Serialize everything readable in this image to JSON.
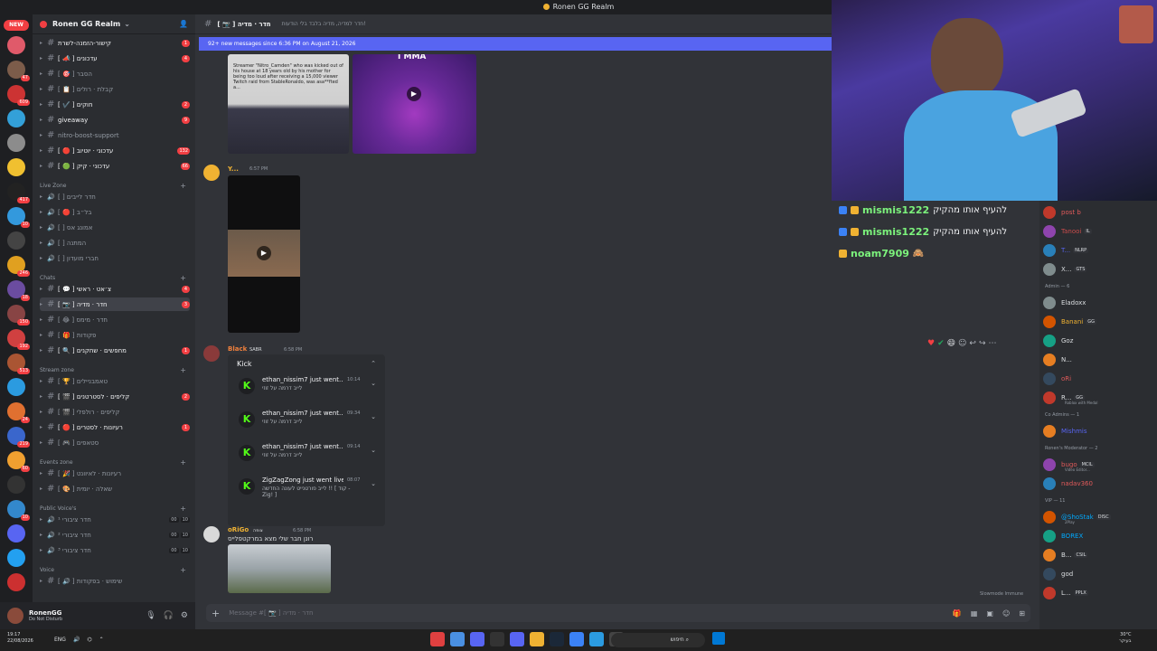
{
  "title_bar": {
    "title": "Ronen GG Realm"
  },
  "rail": {
    "new_label": "NEW",
    "servers": [
      {
        "color": "#e05a6a",
        "badge": ""
      },
      {
        "color": "#7c5c4a",
        "badge": "47"
      },
      {
        "color": "#cc3333",
        "badge": "609"
      },
      {
        "color": "#33a0d8",
        "badge": ""
      },
      {
        "color": "#8c8c8c",
        "badge": ""
      },
      {
        "color": "#f0c030",
        "badge": ""
      },
      {
        "color": "#222222",
        "badge": "417"
      },
      {
        "color": "#3399dd",
        "badge": "10"
      },
      {
        "color": "#444444",
        "badge": ""
      },
      {
        "color": "#e0a020",
        "badge": "246"
      },
      {
        "color": "#6b4ca0",
        "badge": "18"
      },
      {
        "color": "#884444",
        "badge": "150"
      },
      {
        "color": "#d04040",
        "badge": "192"
      },
      {
        "color": "#aa5533",
        "badge": "513"
      },
      {
        "color": "#2b9be0",
        "badge": ""
      },
      {
        "color": "#e07030",
        "badge": "24"
      },
      {
        "color": "#3a66cc",
        "badge": "219"
      },
      {
        "color": "#f0a030",
        "badge": "60"
      },
      {
        "color": "#333333",
        "badge": ""
      },
      {
        "color": "#3388cc",
        "badge": "10"
      },
      {
        "color": "#5865f2",
        "badge": ""
      },
      {
        "color": "#23a0f0",
        "badge": ""
      },
      {
        "color": "#cc3030",
        "badge": ""
      }
    ]
  },
  "server": {
    "name": "Ronen GG Realm"
  },
  "channels": [
    {
      "type": "ch",
      "name": "קישור-הזמנה-לשרת",
      "badge": "1"
    },
    {
      "type": "ch",
      "name": "[ 📣 ] עדכונים",
      "badge": "4"
    },
    {
      "type": "ch",
      "name": "[ 🎯 ] הסבר",
      "badge": ""
    },
    {
      "type": "ch",
      "name": "[ 📋 ] קבלת · רולים",
      "badge": ""
    },
    {
      "type": "ch",
      "name": "[ ✔️ ] חוקים",
      "badge": "2"
    },
    {
      "type": "ch",
      "name": "giveaway",
      "badge": "9"
    },
    {
      "type": "ch",
      "name": "nitro-boost-support",
      "badge": ""
    },
    {
      "type": "ch",
      "name": "[ 🔴 ] עדכוני · יוטיוב",
      "badge": "132"
    },
    {
      "type": "ch",
      "name": "[ 🟢 ] עדכוני · קיק",
      "badge": "66"
    },
    {
      "type": "cat",
      "name": "Live Zone"
    },
    {
      "type": "voice",
      "name": "[ ] חדר לייבים",
      "badge": ""
    },
    {
      "type": "voice",
      "name": "[ 🔴 ] בל״ב",
      "badge": ""
    },
    {
      "type": "voice",
      "name": "[ ] אמונג אס",
      "badge": ""
    },
    {
      "type": "voice",
      "name": "[ ] המתנה",
      "badge": ""
    },
    {
      "type": "voice",
      "name": "[ ] חברי מועדון",
      "badge": ""
    },
    {
      "type": "cat",
      "name": "Chats"
    },
    {
      "type": "ch",
      "name": "[ 💬 ] צ׳אט · ראשי",
      "badge": "4"
    },
    {
      "type": "ch",
      "name": "[ 📷 ] חדר · מדיה",
      "badge": "3",
      "selected": true
    },
    {
      "type": "ch",
      "name": "[ 😂 ] חדר · מימס",
      "badge": ""
    },
    {
      "type": "ch",
      "name": "[ 🎁 ] פקודות",
      "badge": ""
    },
    {
      "type": "ch",
      "name": "[ 🔍 ] מחפשים · שחקנים",
      "badge": "1"
    },
    {
      "type": "cat",
      "name": "Stream zone"
    },
    {
      "type": "ch",
      "name": "[ 🏆 ] טאמבניילים",
      "badge": ""
    },
    {
      "type": "ch",
      "name": "[ 🎬 ] קליפים · לסטרטנים",
      "badge": "2"
    },
    {
      "type": "ch",
      "name": "[ 🎬 ] קליפים · רולפלי",
      "badge": ""
    },
    {
      "type": "ch",
      "name": "[ 🔴 ] רעיונות · לסטרים",
      "badge": "1"
    },
    {
      "type": "ch",
      "name": "[ 🎮 ] סטאפים",
      "badge": ""
    },
    {
      "type": "cat",
      "name": "Events zone"
    },
    {
      "type": "ch",
      "name": "[ 🎉 ] רעיונות · לאיוונט",
      "badge": ""
    },
    {
      "type": "ch",
      "name": "[ 🎨 ] שאלה · יומית",
      "badge": ""
    },
    {
      "type": "cat",
      "name": "Public Voice's"
    },
    {
      "type": "voice",
      "name": "חדר ציבורי ¹",
      "counts": [
        "00",
        "10"
      ]
    },
    {
      "type": "voice",
      "name": "חדר ציבורי ²",
      "counts": [
        "00",
        "10"
      ]
    },
    {
      "type": "voice",
      "name": "חדר ציבורי ³",
      "counts": [
        "00",
        "10"
      ]
    },
    {
      "type": "cat",
      "name": "Voice"
    },
    {
      "type": "ch",
      "name": "[ 🔊 ] שימוש · בפקודות",
      "badge": ""
    }
  ],
  "user": {
    "name": "RonenGG",
    "status": "Do Not Disturb"
  },
  "chat_header": {
    "channel": "[ 📷 ] חדר · מדיה",
    "description": "חדר למדיה, מדיה בלבד בלי הודעות!"
  },
  "new_messages_bar": "92+ new messages since 6:36 PM on August 21, 2026",
  "messages": {
    "embed_text": "Streamer \"Nitro_Camden\" who was kicked out of his house at 18 years old by his mother for being too loud after receiving a 15,000 viewer Twitch raid from StableRonaldo, was asa**fted a...",
    "embed_video_caption": "I MMA",
    "msg2_user": "Y...",
    "msg2_time": "6:57 PM",
    "msg3_user": "Black",
    "msg3_tag": "SABR",
    "msg3_time": "6:58 PM",
    "kick_title": "Kick",
    "kick_items": [
      {
        "title": "ethan_nissim7 just went...",
        "sub": "לייב דרמה על זוזי",
        "time": "10:14"
      },
      {
        "title": "ethan_nissim7 just went...",
        "sub": "לייב דרמה על זוזי",
        "time": "09:34"
      },
      {
        "title": "ethan_nissim7 just went...",
        "sub": "לייב דרמה על זוזי",
        "time": "09:14"
      },
      {
        "title": "ZigZagZong just went live!",
        "sub": "לייב פורטנייט לעונה החדשה !! [ קוד - Zig! ]",
        "time": "08:07"
      }
    ],
    "msg4_user": "oRiGo",
    "msg4_tag": "צופה",
    "msg4_time": "6:58 PM",
    "msg4_text": "רונן חבר שלי מצא במרקטפלייס"
  },
  "input": {
    "placeholder": "Message #[ 📷 ] חדר · מדיה",
    "slowmode": "Slowmode Immune"
  },
  "overlay_chat": [
    {
      "user": "mismis1222",
      "msg": "להעיף אותו מהקיק"
    },
    {
      "user": "mismis1222",
      "msg": "להעיף אותו מהקיק"
    },
    {
      "user": "noam7909",
      "msg": "🙈"
    }
  ],
  "members": {
    "groups": [
      {
        "label": "",
        "items": [
          {
            "name": "post b",
            "color": "#e05a5a",
            "tag": ""
          },
          {
            "name": "Tanooi",
            "color": "#c94b4b",
            "tag": "IL"
          },
          {
            "name": "T...",
            "color": "#5865f2",
            "tag": "NLRP"
          },
          {
            "name": "X...",
            "color": "#dbdee1",
            "tag": "GTS"
          }
        ]
      },
      {
        "label": "Admin — 6",
        "items": [
          {
            "name": "Eladoxx",
            "color": "#dbdee1",
            "tag": ""
          },
          {
            "name": "Banani",
            "color": "#f0b232",
            "tag": "GG"
          },
          {
            "name": "Goz",
            "color": "#dbdee1",
            "tag": ""
          },
          {
            "name": "N...",
            "color": "#dbdee1",
            "tag": ""
          },
          {
            "name": "oRi",
            "color": "#e05a5a",
            "tag": ""
          },
          {
            "name": "R...",
            "color": "#dbdee1",
            "tag": "GG",
            "sub": "Roblox with Medal"
          }
        ]
      },
      {
        "label": "Co Admins — 1",
        "items": [
          {
            "name": "Mishmis",
            "color": "#5865f2",
            "tag": ""
          }
        ]
      },
      {
        "label": "Ronen's Moderator — 2",
        "items": [
          {
            "name": "bugo",
            "color": "#e05a5a",
            "tag": "MCIL",
            "sub": "Video Editor..."
          },
          {
            "name": "nadav360",
            "color": "#e05a5a",
            "tag": ""
          }
        ]
      },
      {
        "label": "VIP — 11",
        "items": [
          {
            "name": "@ShoStak",
            "color": "#00a8fc",
            "tag": "DISC",
            "sub": "2Play"
          },
          {
            "name": "BOREX",
            "color": "#00a8fc",
            "tag": ""
          },
          {
            "name": "B...",
            "color": "#dbdee1",
            "tag": "CSIL"
          },
          {
            "name": "god",
            "color": "#dbdee1",
            "tag": ""
          },
          {
            "name": "L...",
            "color": "#dbdee1",
            "tag": "PPLX"
          }
        ]
      }
    ]
  },
  "taskbar": {
    "time": "19:17",
    "date": "22/08/2026",
    "lang": "ENG",
    "search": "חיפוש",
    "weather": "30°C",
    "weather_sub": "בעיקר"
  }
}
